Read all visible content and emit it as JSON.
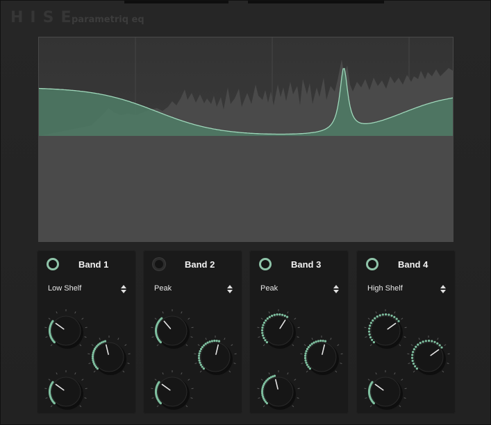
{
  "header": {
    "logo": "HISE",
    "subtitle": "parametriq eq"
  },
  "colors": {
    "accent": "#7fc0a0",
    "curve_fill": "#4f7d66",
    "panel": "#1a1a1a"
  },
  "bands": [
    {
      "title": "Band 1",
      "enabled": true,
      "type": "Low Shelf",
      "knobs": [
        0.3,
        0.45,
        0.3
      ]
    },
    {
      "title": "Band 2",
      "enabled": false,
      "type": "Peak",
      "knobs": [
        0.35,
        0.55,
        0.3
      ]
    },
    {
      "title": "Band 3",
      "enabled": true,
      "type": "Peak",
      "knobs": [
        0.62,
        0.55,
        0.45
      ]
    },
    {
      "title": "Band 4",
      "enabled": true,
      "type": "High Shelf",
      "knobs": [
        0.7,
        0.7,
        0.3
      ]
    }
  ]
}
